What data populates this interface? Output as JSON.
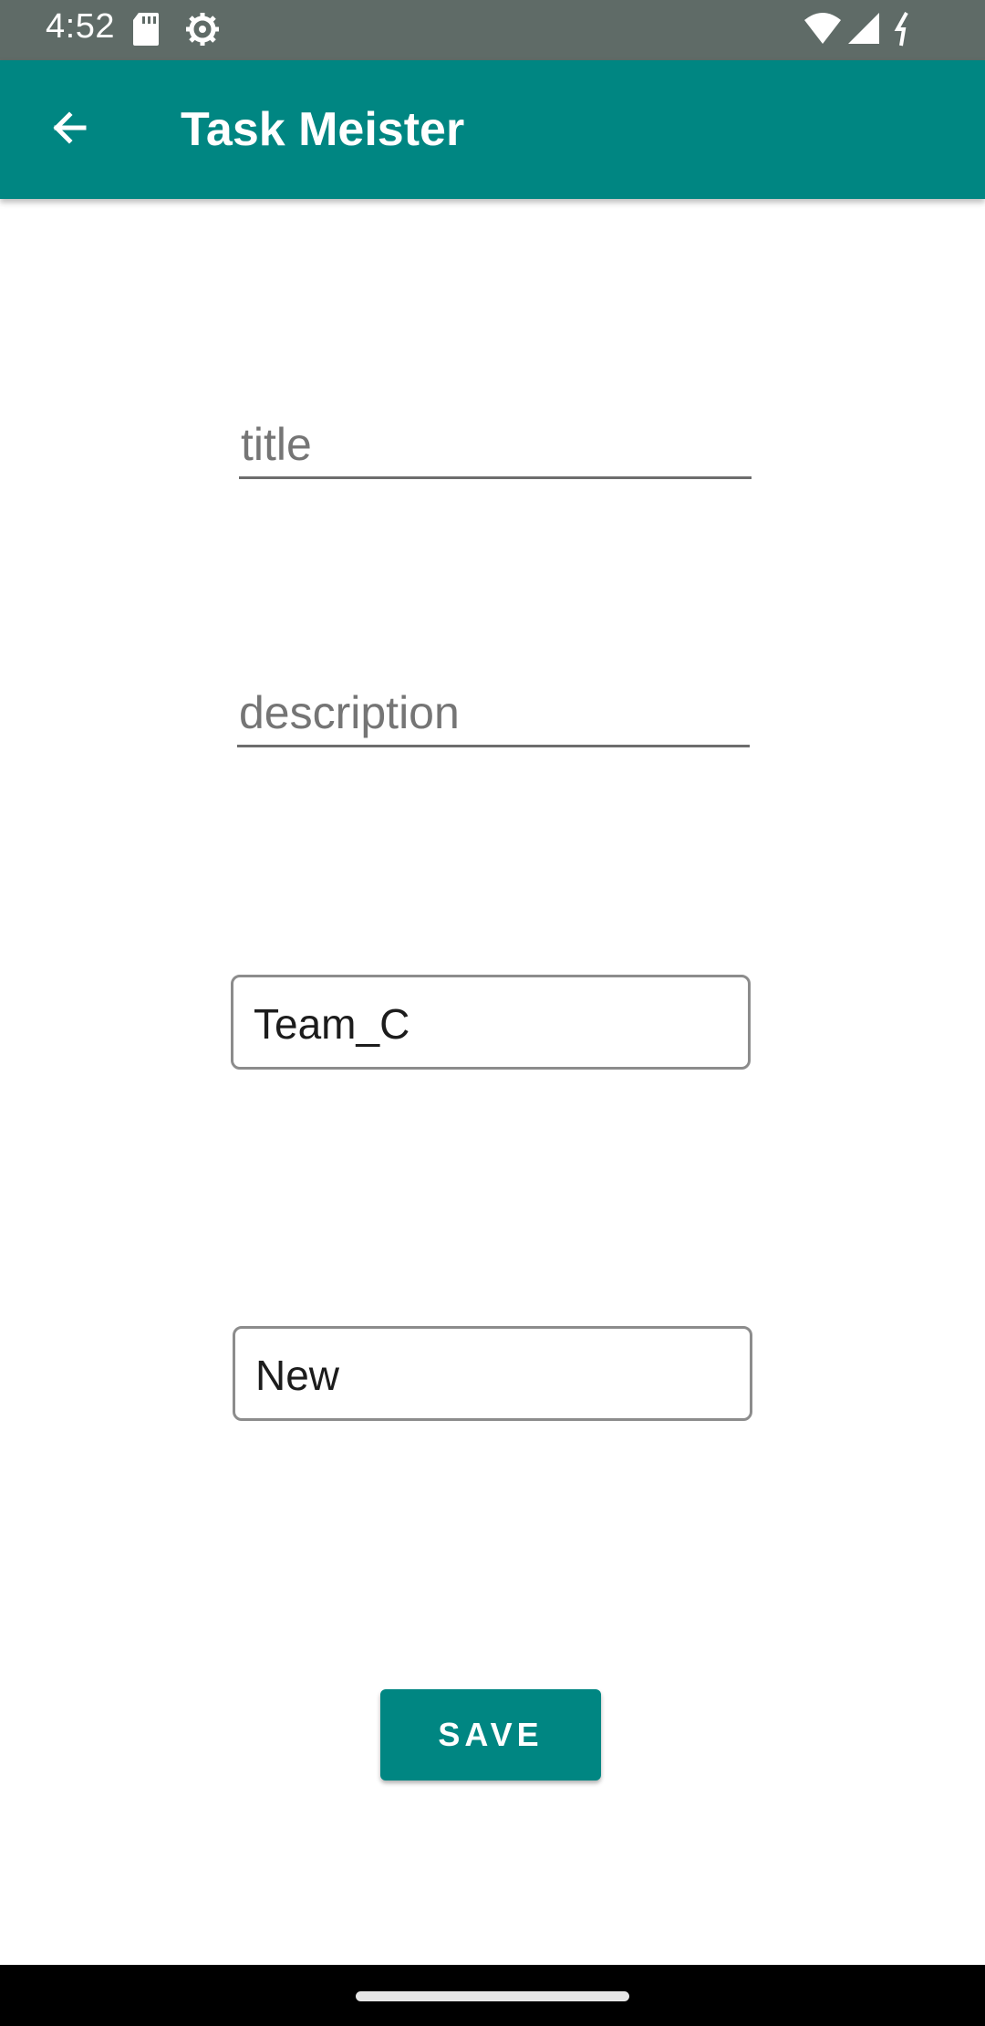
{
  "status_bar": {
    "time": "4:52",
    "icons": [
      "sd-card-icon",
      "settings-gear-icon",
      "wifi-icon",
      "cell-signal-icon",
      "battery-icon"
    ]
  },
  "app_bar": {
    "title": "Task Meister",
    "back_icon": "arrow-back-icon",
    "background": "#008682"
  },
  "form": {
    "title_placeholder": "title",
    "description_placeholder": "description",
    "team_value": "Team_C",
    "status_value": "New",
    "save_label": "SAVE"
  },
  "colors": {
    "accent": "#008682",
    "status_bar": "#5f6b67"
  }
}
